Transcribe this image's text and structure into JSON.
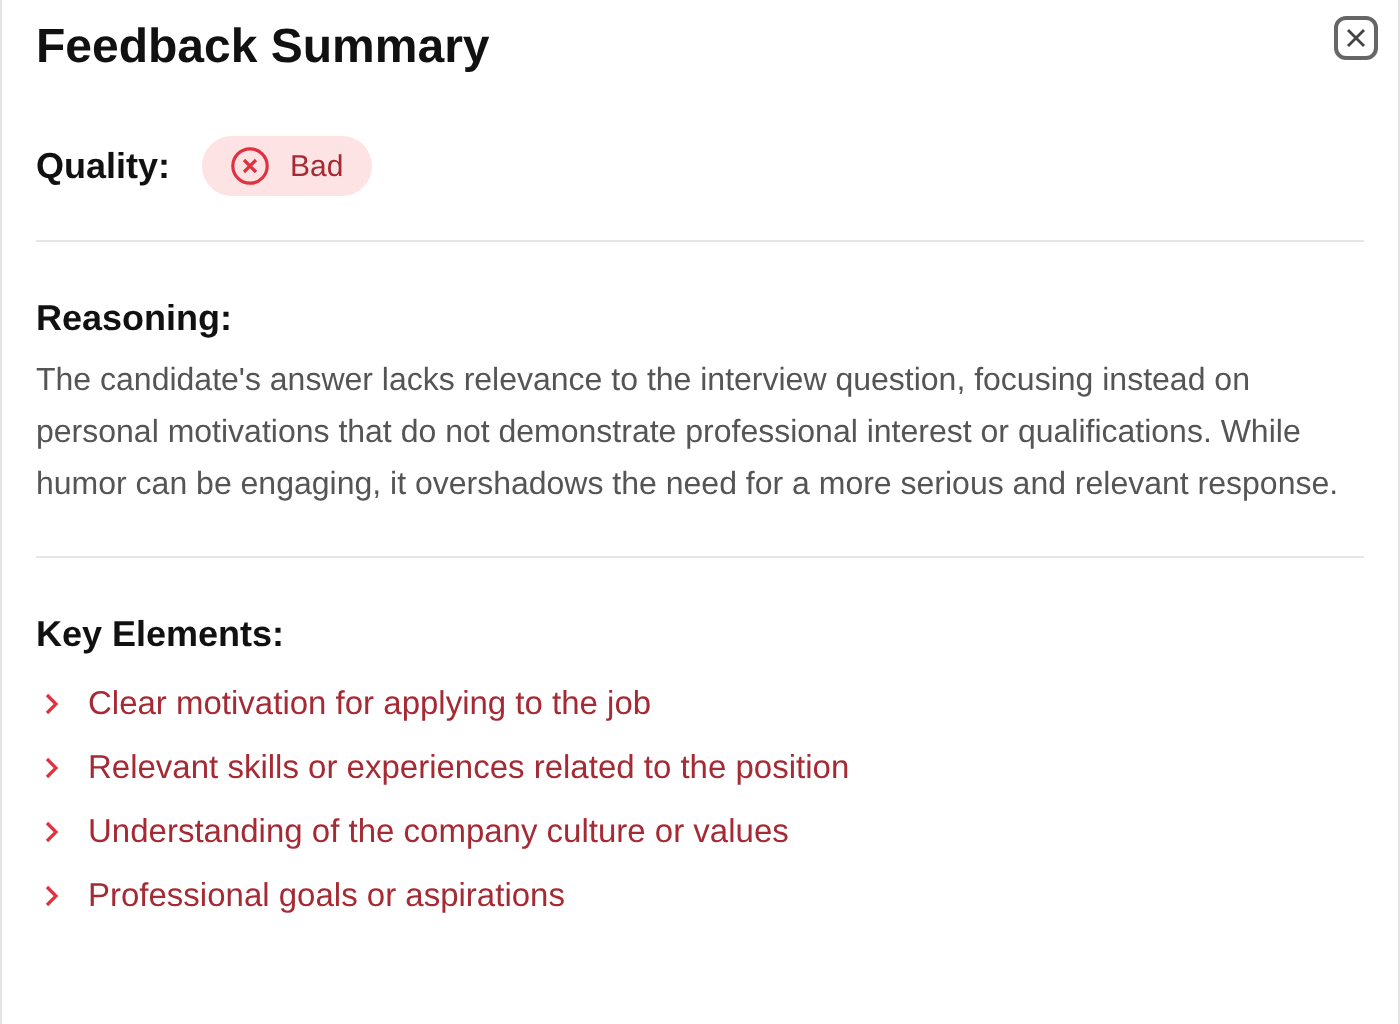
{
  "title": "Feedback Summary",
  "quality": {
    "label": "Quality:",
    "value": "Bad",
    "kind": "bad"
  },
  "reasoning": {
    "heading": "Reasoning:",
    "text": "The candidate's answer lacks relevance to the interview question, focusing instead on personal motivations that do not demonstrate professional interest or qualifications. While humor can be engaging, it overshadows the need for a more serious and relevant response."
  },
  "key_elements": {
    "heading": "Key Elements:",
    "items": [
      "Clear motivation for applying to the job",
      "Relevant skills or experiences related to the position",
      "Understanding of the company culture or values",
      "Professional goals or aspirations"
    ]
  }
}
